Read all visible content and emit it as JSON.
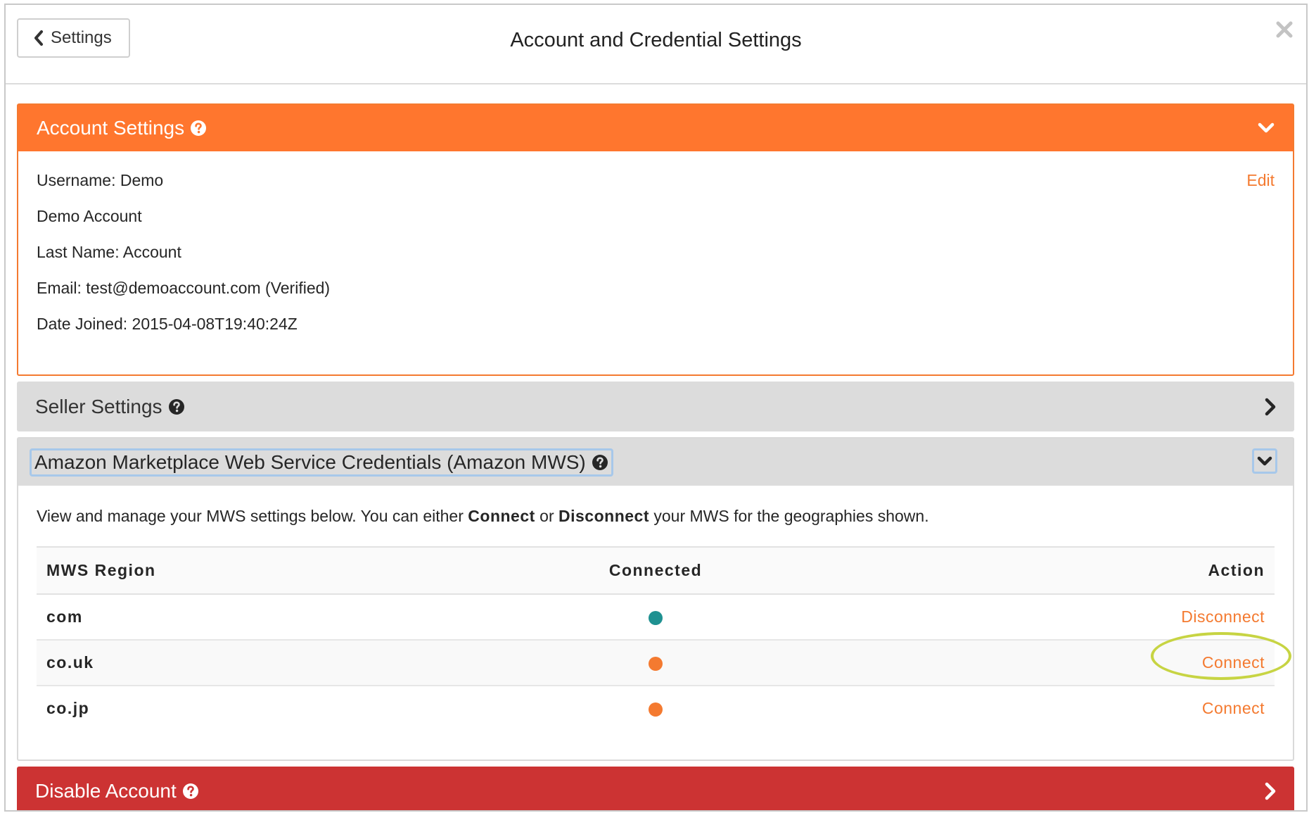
{
  "header": {
    "back_label": "Settings",
    "title": "Account and Credential Settings",
    "close_icon": "close-icon"
  },
  "colors": {
    "accent": "#ff762e",
    "danger": "#cc3333",
    "connected": "#1f9191",
    "disconnected": "#f47a30",
    "panel_gray": "#dcdcdc"
  },
  "account_panel": {
    "title": "Account Settings",
    "edit_label": "Edit",
    "lines": [
      "Username: Demo",
      "Demo Account",
      "Last Name: Account",
      "Email: test@demoaccount.com (Verified)",
      "Date Joined: 2015-04-08T19:40:24Z"
    ]
  },
  "seller_panel": {
    "title": "Seller Settings"
  },
  "mws_panel": {
    "title": "Amazon Marketplace Web Service Credentials (Amazon MWS)",
    "desc_pre": "View and manage your MWS settings below. You can either ",
    "desc_connect": "Connect",
    "desc_mid": " or ",
    "desc_disconnect": "Disconnect",
    "desc_post": " your MWS for the geographies shown.",
    "columns": [
      "MWS Region",
      "Connected",
      "Action"
    ],
    "rows": [
      {
        "region": "com",
        "connected": true,
        "action": "Disconnect"
      },
      {
        "region": "co.uk",
        "connected": false,
        "action": "Connect"
      },
      {
        "region": "co.jp",
        "connected": false,
        "action": "Connect"
      }
    ]
  },
  "disable_panel": {
    "title": "Disable Account"
  }
}
